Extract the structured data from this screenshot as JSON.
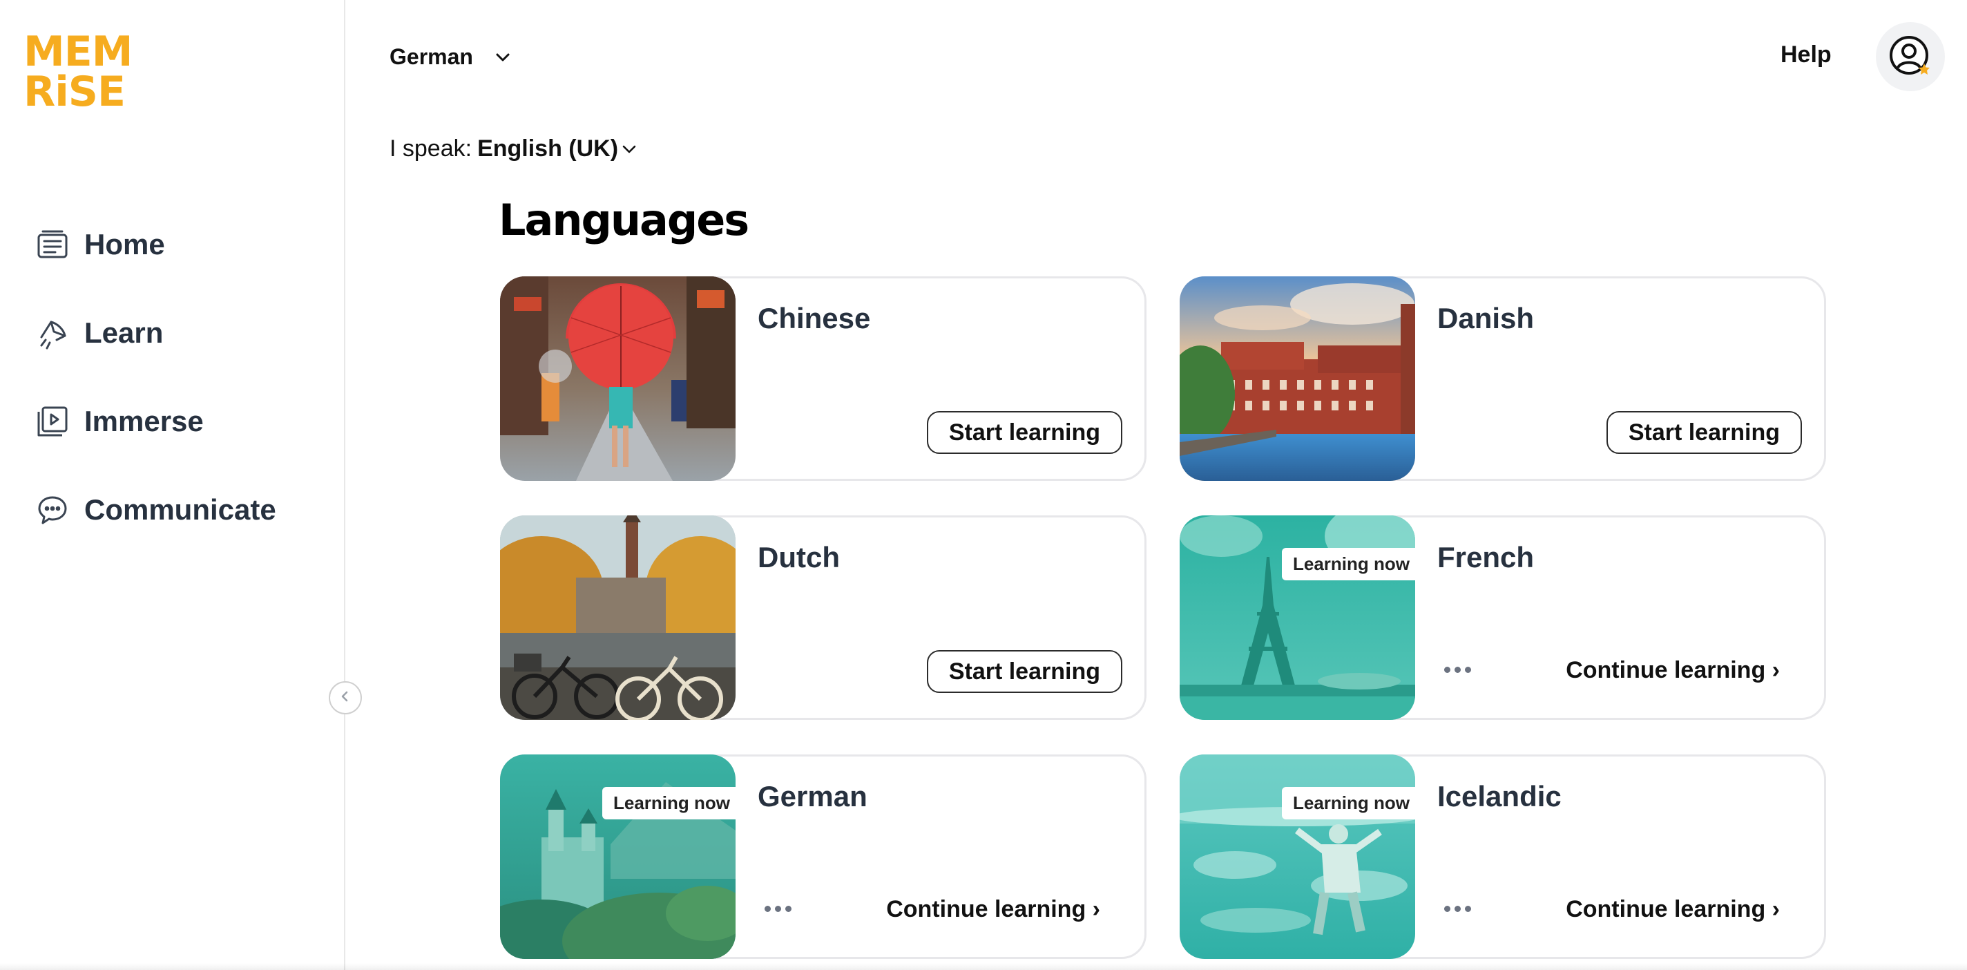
{
  "logo": {
    "line1": "MEM",
    "line2": "RiSE",
    "color": "#f6ac1f"
  },
  "sidebar": {
    "items": [
      {
        "label": "Home",
        "icon": "home-icon"
      },
      {
        "label": "Learn",
        "icon": "learn-icon"
      },
      {
        "label": "Immerse",
        "icon": "immerse-icon"
      },
      {
        "label": "Communicate",
        "icon": "communicate-icon"
      }
    ],
    "collapse_icon": "chevron-left-icon"
  },
  "header": {
    "language": "German",
    "help": "Help",
    "avatar_icon": "user-avatar-icon"
  },
  "speak": {
    "label": "I speak:",
    "value": "English (UK)"
  },
  "main": {
    "title": "Languages",
    "cards": [
      {
        "name": "Chinese",
        "action": "Start learning",
        "learning": false
      },
      {
        "name": "Danish",
        "action": "Start learning",
        "learning": false
      },
      {
        "name": "Dutch",
        "action": "Start learning",
        "learning": false
      },
      {
        "name": "French",
        "badge": "Learning now",
        "action": "Continue learning ›",
        "learning": true
      },
      {
        "name": "German",
        "badge": "Learning now",
        "action": "Continue learning ›",
        "learning": true
      },
      {
        "name": "Icelandic",
        "badge": "Learning now",
        "action": "Continue learning ›",
        "learning": true
      }
    ]
  },
  "colors": {
    "accent": "#f6ac1f",
    "text": "#27313f",
    "learning_tint": "#2fb7a4"
  }
}
